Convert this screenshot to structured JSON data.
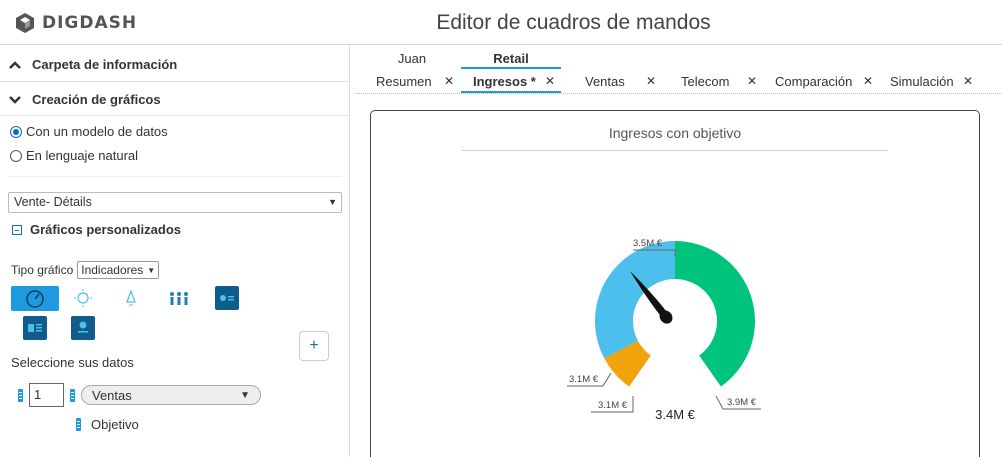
{
  "app": {
    "logo_text": "DIGDASH",
    "title": "Editor de cuadros de mandos"
  },
  "left_panel": {
    "section_info": "Carpeta de información",
    "section_charts": "Creación de gráficos",
    "radio_model": "Con un modelo de datos",
    "radio_natural": "En lenguaje natural",
    "datamodel_select": "Vente- Détails",
    "custom_charts": "Gráficos personalizados",
    "chart_type_label": "Tipo gráfico",
    "chart_type_value": "Indicadores",
    "select_data_label": "Seleccione sus datos",
    "measure_index": "1",
    "measure_value": "Ventas",
    "objective_label": "Objetivo"
  },
  "tabs": {
    "group1": "Juan",
    "group2": "Retail",
    "items": [
      "Resumen",
      "Ingresos *",
      "Ventas",
      "Telecom",
      "Comparación",
      "Simulación"
    ],
    "active": "Ingresos *"
  },
  "chart_data": {
    "type": "gauge",
    "title": "Ingresos con objetivo",
    "value": 3.4,
    "value_label": "3.4M €",
    "min": 3.1,
    "max": 3.9,
    "bands": [
      {
        "from": 3.1,
        "to": 3.1,
        "label": "3.1M €",
        "color": "#f0a30a"
      },
      {
        "from": 3.1,
        "to": 3.5,
        "label": "3.1M €",
        "color": "#4dbfec"
      },
      {
        "from": 3.5,
        "to": 3.9,
        "label": "3.5M €",
        "color": "#00c47d"
      }
    ],
    "labels": [
      "3.5M €",
      "3.1M €",
      "3.1M €",
      "3.9M €"
    ]
  },
  "colors": {
    "accent": "#1e9be0",
    "dark_icon": "#0f5b8a"
  }
}
